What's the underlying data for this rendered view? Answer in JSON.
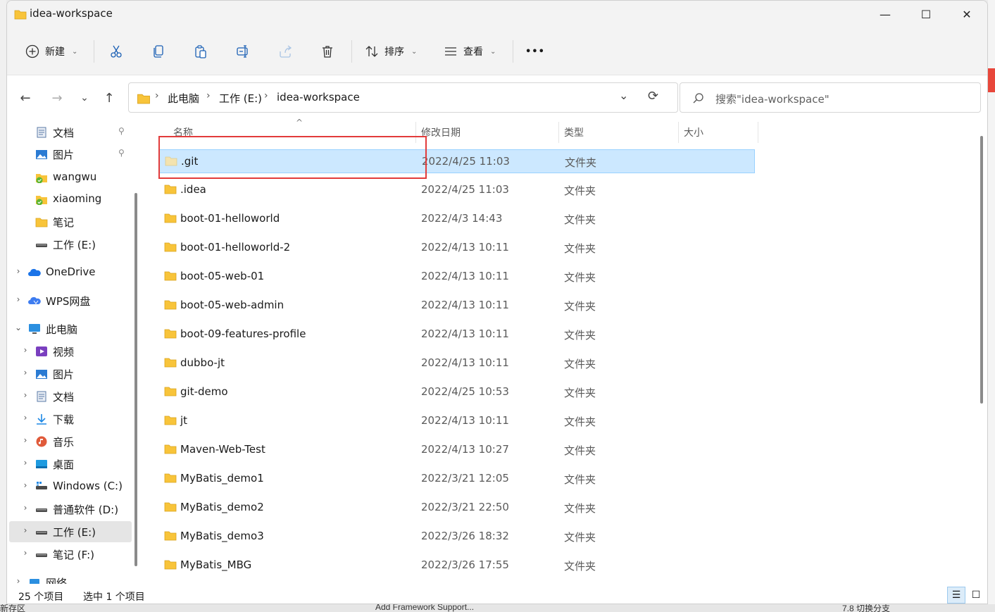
{
  "window": {
    "title": "idea-workspace",
    "minimize_glyph": "—",
    "maximize_glyph": "☐",
    "close_glyph": "✕"
  },
  "toolbar": {
    "new_label": "新建",
    "sort_label": "排序",
    "view_label": "查看",
    "more_glyph": "•••",
    "cut_icon": "scissors-icon",
    "copy_icon": "copy-icon",
    "paste_icon": "paste-icon",
    "rename_icon": "rename-icon",
    "share_icon": "share-icon",
    "delete_icon": "trash-icon"
  },
  "nav": {
    "back_glyph": "←",
    "forward_glyph": "→",
    "recent_glyph": "⌄",
    "up_glyph": "↑"
  },
  "address": {
    "crumbs": [
      "此电脑",
      "工作 (E:)",
      "idea-workspace"
    ],
    "separator": "›",
    "dropdown_glyph": "⌄",
    "refresh_glyph": "⟳"
  },
  "search": {
    "placeholder": "搜索\"idea-workspace\""
  },
  "sidebar": {
    "pin_glyph": "📌",
    "items": [
      {
        "label": "文档",
        "icon": "document-icon",
        "pinned": true
      },
      {
        "label": "图片",
        "icon": "pictures-icon",
        "pinned": true
      },
      {
        "label": "wangwu",
        "icon": "synced-folder-icon"
      },
      {
        "label": "xiaoming",
        "icon": "synced-folder-icon"
      },
      {
        "label": "笔记",
        "icon": "folder-icon"
      },
      {
        "label": "工作 (E:)",
        "icon": "drive-icon"
      },
      {
        "label": "OneDrive",
        "icon": "onedrive-cloud-icon",
        "expander": "›"
      },
      {
        "label": "WPS网盘",
        "icon": "wps-cloud-icon",
        "expander": "›"
      },
      {
        "label": "此电脑",
        "icon": "monitor-icon",
        "expander": "⌄"
      },
      {
        "label": "视频",
        "icon": "video-icon",
        "expander": "›"
      },
      {
        "label": "图片",
        "icon": "pictures-icon",
        "expander": "›"
      },
      {
        "label": "文档",
        "icon": "document-icon",
        "expander": "›"
      },
      {
        "label": "下载",
        "icon": "download-icon",
        "expander": "›"
      },
      {
        "label": "音乐",
        "icon": "music-icon",
        "expander": "›"
      },
      {
        "label": "桌面",
        "icon": "desktop-icon",
        "expander": "›"
      },
      {
        "label": "Windows (C:)",
        "icon": "windows-drive-icon",
        "expander": "›"
      },
      {
        "label": "普通软件 (D:)",
        "icon": "drive-icon",
        "expander": "›"
      },
      {
        "label": "工作 (E:)",
        "icon": "drive-icon",
        "expander": "›",
        "selected": true
      },
      {
        "label": "笔记 (F:)",
        "icon": "drive-icon",
        "expander": "›"
      },
      {
        "label": "网络",
        "icon": "network-icon",
        "expander": "›"
      }
    ]
  },
  "columns": {
    "name": "名称",
    "date": "修改日期",
    "type": "类型",
    "size": "大小",
    "sort_glyph": "^"
  },
  "files": [
    {
      "name": ".git",
      "date": "2022/4/25 11:03",
      "type": "文件夹",
      "selected": true,
      "hidden": true
    },
    {
      "name": ".idea",
      "date": "2022/4/25 11:03",
      "type": "文件夹"
    },
    {
      "name": "boot-01-helloworld",
      "date": "2022/4/3 14:43",
      "type": "文件夹"
    },
    {
      "name": "boot-01-helloworld-2",
      "date": "2022/4/13 10:11",
      "type": "文件夹"
    },
    {
      "name": "boot-05-web-01",
      "date": "2022/4/13 10:11",
      "type": "文件夹"
    },
    {
      "name": "boot-05-web-admin",
      "date": "2022/4/13 10:11",
      "type": "文件夹"
    },
    {
      "name": "boot-09-features-profile",
      "date": "2022/4/13 10:11",
      "type": "文件夹"
    },
    {
      "name": "dubbo-jt",
      "date": "2022/4/13 10:11",
      "type": "文件夹"
    },
    {
      "name": "git-demo",
      "date": "2022/4/25 10:53",
      "type": "文件夹"
    },
    {
      "name": "jt",
      "date": "2022/4/13 10:11",
      "type": "文件夹"
    },
    {
      "name": "Maven-Web-Test",
      "date": "2022/4/13 10:27",
      "type": "文件夹"
    },
    {
      "name": "MyBatis_demo1",
      "date": "2022/3/21 12:05",
      "type": "文件夹"
    },
    {
      "name": "MyBatis_demo2",
      "date": "2022/3/21 22:50",
      "type": "文件夹"
    },
    {
      "name": "MyBatis_demo3",
      "date": "2022/3/26 18:32",
      "type": "文件夹"
    },
    {
      "name": "MyBatis_MBG",
      "date": "2022/3/26 17:55",
      "type": "文件夹"
    }
  ],
  "status": {
    "count": "25 个项目",
    "selected": "选中 1 个项目",
    "details_view_glyph": "☰",
    "tiles_view_glyph": "☐"
  },
  "background": {
    "bottom_text_1": "Add Framework Support...",
    "bottom_text_2": "7.8 切换分支",
    "bottom_text_3": "新存区"
  },
  "colors": {
    "selection": "#cce8ff",
    "folder": "#f8c43a",
    "annotation": "#e23b3b"
  }
}
